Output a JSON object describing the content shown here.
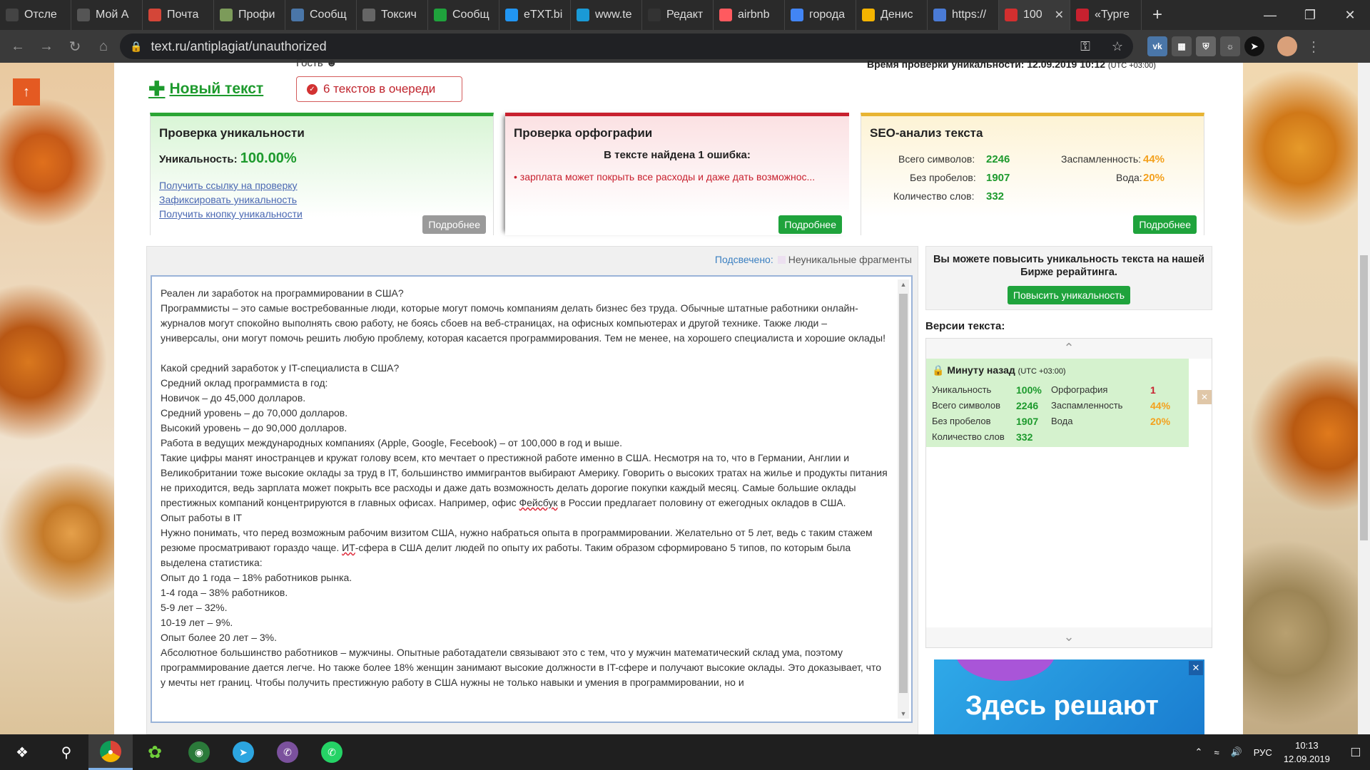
{
  "browser": {
    "tabs": [
      {
        "label": "Отсле",
        "color": "#444"
      },
      {
        "label": "Мой А",
        "color": "#555"
      },
      {
        "label": "Почта",
        "color": "#d44638"
      },
      {
        "label": "Профи",
        "color": "#7c9b5a"
      },
      {
        "label": "Сообщ",
        "color": "#4a76a8"
      },
      {
        "label": "Токсич",
        "color": "#666"
      },
      {
        "label": "Сообщ",
        "color": "#1fa33c"
      },
      {
        "label": "eTXT.bi",
        "color": "#2196f3"
      },
      {
        "label": "www.te",
        "color": "#1a9ad6"
      },
      {
        "label": "Редакт",
        "color": "#333"
      },
      {
        "label": "airbnb",
        "color": "#ff5a5f"
      },
      {
        "label": "города",
        "color": "#4285f4"
      },
      {
        "label": "Денис",
        "color": "#f4b400"
      },
      {
        "label": "https://",
        "color": "#4a7bd6"
      },
      {
        "label": "100",
        "color": "#d32f2f"
      },
      {
        "label": "«Турге",
        "color": "#c8212f"
      }
    ],
    "url": "text.ru/antiplagiat/unauthorized"
  },
  "header": {
    "guest": "Гость",
    "check_time": "Время проверки уникальности: 12.09.2019 10:12",
    "check_tz": "(UTC +03:00)",
    "new_text": "Новый текст",
    "queue": "6 текстов в очереди"
  },
  "uniq_card": {
    "title": "Проверка уникальности",
    "label": "Уникальность:",
    "value": "100.00%",
    "links": [
      "Получить ссылку на проверку",
      "Зафиксировать уникальность",
      "Получить кнопку уникальности"
    ],
    "more": "Подробнее"
  },
  "spell_card": {
    "title": "Проверка орфографии",
    "found": "В тексте найдена 1 ошибка:",
    "error": "• зарплата может покрыть все расходы и даже дать возможнос...",
    "more": "Подробнее"
  },
  "seo_card": {
    "title": "SEO-анализ текста",
    "total_label": "Всего символов:",
    "total": "2246",
    "nospace_label": "Без пробелов:",
    "nospace": "1907",
    "words_label": "Количество слов:",
    "words": "332",
    "spam_label": "Заспамленность:",
    "spam": "44%",
    "water_label": "Вода:",
    "water": "20%",
    "more": "Подробнее"
  },
  "editor": {
    "highlight_label": "Подсвечено:",
    "highlight_legend": "Неуникальные фрагменты",
    "text_before": "Реален ли заработок на программировании в США?\nПрограммисты – это самые востребованные люди, которые могут помочь компаниям делать бизнес без труда. Обычные штатные работники онлайн-журналов могут спокойно выполнять свою работу, не боясь сбоев на веб-страницах, на офисных компьютерах и другой технике. Также люди – универсалы, они могут помочь решить любую проблему, которая касается программирования. Тем не менее, на хорошего специалиста и хорошие оклады!\n\nКакой средний заработок у IT-специалиста в США?\nСредний оклад программиста в год:\nНовичок – до 45,000 долларов.\nСредний уровень – до 70,000 долларов.\nВысокий уровень – до 90,000 долларов.\nРабота в ведущих международных компаниях (Apple, Google, Fecebook) – от 100,000 в год и выше.\nТакие цифры манят иностранцев и кружат голову всем, кто мечтает о престижной работе именно в США. Несмотря на то, что в Германии, Англии и Великобритании тоже высокие оклады за труд в IT, большинство иммигрантов выбирают Америку. Говорить о высоких тратах на жилье и продукты питания не приходится, ведь зарплата может покрыть все расходы и даже дать возможность делать дорогие покупки каждый месяц. Самые большие оклады престижных компаний концентрируются в главных офисах. Например, офис ",
    "word1": "Фейсбук",
    "text_mid": " в России предлагает половину от ежегодных окладов в США.\nОпыт работы в IT\nНужно понимать, что перед возможным рабочим визитом США, нужно набраться опыта в программировании. Желательно от 5 лет, ведь с таким стажем резюме просматривают гораздо чаще. ",
    "word2": "ИТ",
    "text_after": "-сфера в США делит людей по опыту их работы. Таким образом сформировано 5 типов, по которым была выделена статистика:\nОпыт до 1 года – 18% работников рынка.\n1-4 года – 38% работников.\n5-9 лет – 32%.\n10-19 лет – 9%.\nОпыт более 20 лет – 3%.\nАбсолютное большинство работников – мужчины. Опытные работадатели связывают это с тем, что у мужчин математический склад ума, поэтому программирование дается легче. Но также более 18% женщин занимают высокие должности в IT-сфере и получают высокие оклады. Это доказывает, что у мечты нет границ. Чтобы получить престижную работу в США нужны не только навыки и умения в программировании, но и"
  },
  "sidebar": {
    "promo": "Вы можете повысить уникальность текста на нашей Бирже рерайтинга.",
    "promo_button": "Повысить уникальность",
    "versions_title": "Версии текста:",
    "version": {
      "when": "Минуту назад",
      "tz": "(UTC +03:00)",
      "uniq_label": "Уникальность",
      "uniq": "100%",
      "spell_label": "Орфография",
      "spell": "1",
      "total_label": "Всего символов",
      "total": "2246",
      "spam_label": "Заспамленность",
      "spam": "44%",
      "nospace_label": "Без пробелов",
      "nospace": "1907",
      "water_label": "Вода",
      "water": "20%",
      "words_label": "Количество слов",
      "words": "332"
    }
  },
  "ad": {
    "text": "Здесь решают"
  },
  "taskbar": {
    "lang": "РУС",
    "time": "10:13",
    "date": "12.09.2019"
  }
}
